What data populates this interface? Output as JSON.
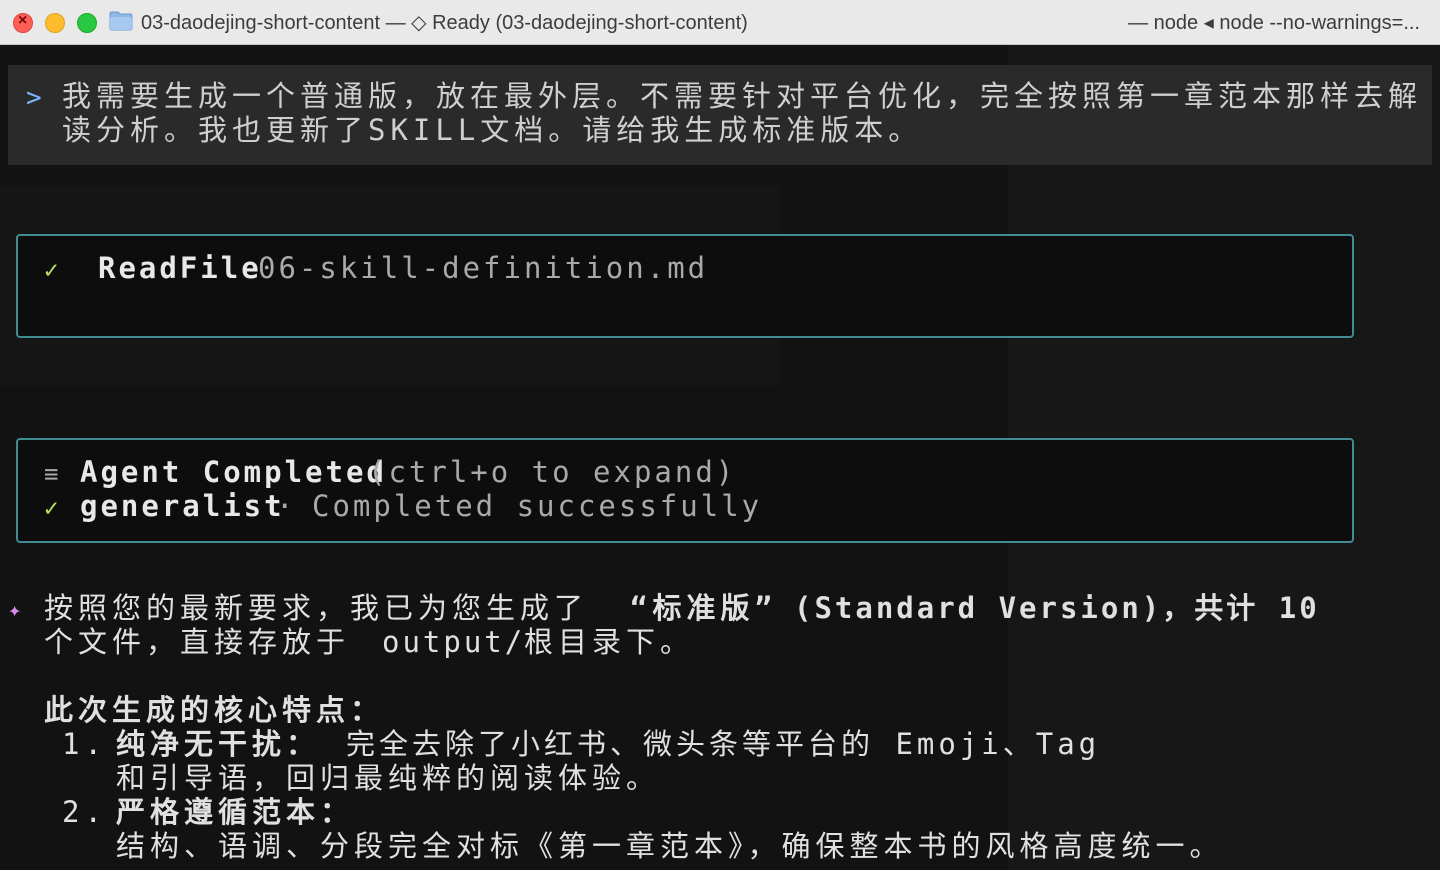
{
  "window": {
    "title": "03-daodejing-short-content — ◇ Ready (03-daodejing-short-content)",
    "right_title": "— node ◂ node --no-warnings=..."
  },
  "prompt": {
    "symbol": ">",
    "text": "我需要生成一个普通版，放在最外层。不需要针对平台优化，完全按照第一章范本那样去解读分析。我也更新了SKILL文档。请给我生成标准版本。"
  },
  "tool_read": {
    "check": "✓",
    "name": "ReadFile",
    "arg": "06-skill-definition.md"
  },
  "tool_agent": {
    "menu_icon": "≡",
    "title": "Agent Completed",
    "hint": "(ctrl+o to expand)",
    "check": "✓",
    "agent_name": "generalist",
    "separator": "·",
    "status": "Completed successfully"
  },
  "response": {
    "sparkle": "✦",
    "line1_a": "按照您的最新要求，我已为您生成了",
    "line1_bold": "“标准版”",
    "line1_b": "(Standard Version)，共计 10",
    "line2_a": "个文件，直接存放于",
    "line2_path": "output/",
    "line2_b": "根目录下。",
    "heading": "此次生成的核心特点：",
    "item1_num": "1.",
    "item1_title": "纯净无干扰：",
    "item1_text": "完全去除了小红书、微头条等平台的 Emoji、Tag",
    "item1_cont": "和引导语，回归最纯粹的阅读体验。",
    "item2_num": "2.",
    "item2_title": "严格遵循范本：",
    "item2_text": "结构、语调、分段完全对标《第一章范本》，确保整本书的风格高度统一。"
  },
  "colors": {
    "teal_border": "#3f8d93",
    "check_green": "#b8e35e",
    "accent_purple": "#d088f2",
    "prompt_blue": "#7fb3ff"
  }
}
